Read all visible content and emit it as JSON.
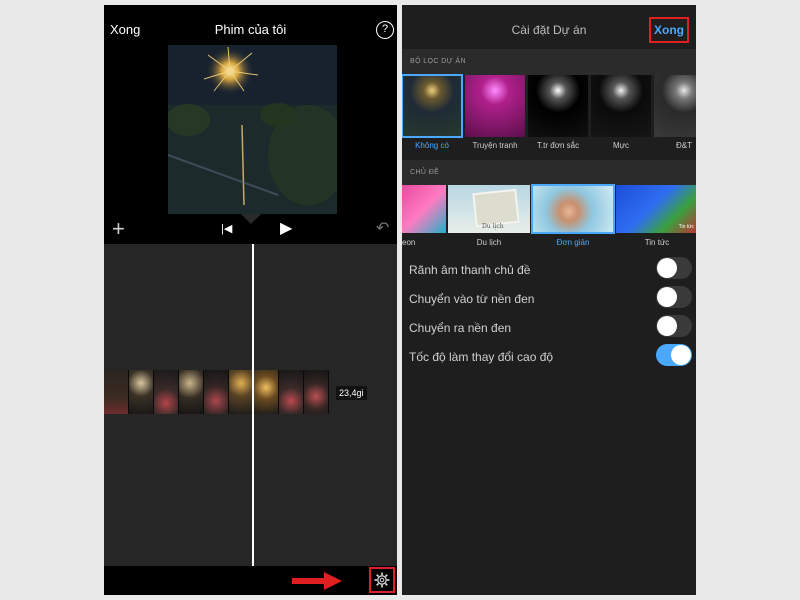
{
  "left_screen": {
    "done_label": "Xong",
    "title": "Phim của tôi",
    "help_label": "?",
    "duration": "23,4gi"
  },
  "right_screen": {
    "title": "Cài đặt Dự án",
    "done_label": "Xong",
    "filters_section": "BỘ LỌC DỰ ÁN",
    "filters": [
      {
        "label": "Không có",
        "selected": true
      },
      {
        "label": "Truyện tranh",
        "selected": false
      },
      {
        "label": "T.tr đơn sắc",
        "selected": false
      },
      {
        "label": "Mực",
        "selected": false
      },
      {
        "label": "Đ&T",
        "selected": false
      }
    ],
    "themes_section": "CHỦ ĐỀ",
    "themes": [
      {
        "label": "eon",
        "selected": false
      },
      {
        "label": "Du lịch",
        "selected": false
      },
      {
        "label": "Đơn giản",
        "selected": true
      },
      {
        "label": "Tin tức",
        "selected": false
      }
    ],
    "theme_thumb_texts": [
      "Du lịch",
      "Tin tức"
    ],
    "options": [
      {
        "label": "Rãnh âm thanh chủ đề",
        "on": false
      },
      {
        "label": "Chuyển vào từ nền đen",
        "on": false
      },
      {
        "label": "Chuyển ra nền đen",
        "on": false
      },
      {
        "label": "Tốc độ làm thay đổi cao độ",
        "on": true
      }
    ]
  },
  "colors": {
    "accent_blue": "#4aa9ff",
    "highlight_red": "#e02020"
  },
  "icons": [
    "plus-icon",
    "skip-back-icon",
    "play-icon",
    "undo-icon",
    "gear-icon",
    "arrow-right-icon",
    "help-icon"
  ]
}
